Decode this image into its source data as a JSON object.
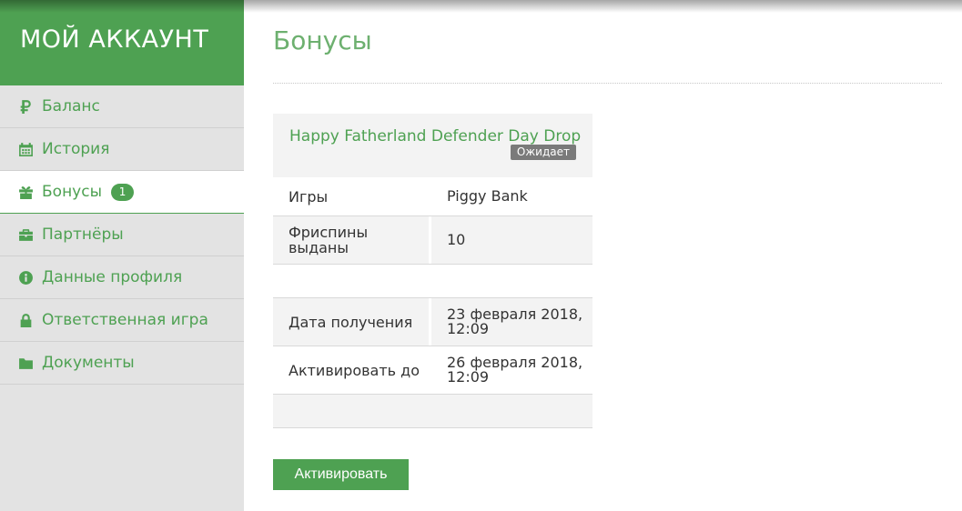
{
  "sidebar": {
    "title": "МОЙ АККАУНТ",
    "items": [
      {
        "label": "Баланс",
        "icon": "ruble-icon"
      },
      {
        "label": "История",
        "icon": "calendar-icon"
      },
      {
        "label": "Бонусы",
        "icon": "gift-icon",
        "badge": "1",
        "active": true
      },
      {
        "label": "Партнёры",
        "icon": "briefcase-icon"
      },
      {
        "label": "Данные профиля",
        "icon": "info-icon"
      },
      {
        "label": "Ответственная игра",
        "icon": "lock-icon"
      },
      {
        "label": "Документы",
        "icon": "folder-icon"
      }
    ]
  },
  "main": {
    "title": "Бонусы",
    "bonus": {
      "name": "Happy Fatherland Defender Day Drop",
      "status": "Ожидает",
      "rows": [
        {
          "label": "Игры",
          "value": "Piggy Bank"
        },
        {
          "label": "Фриспины выданы",
          "value": "10"
        },
        {
          "label": "",
          "value": ""
        },
        {
          "label": "Дата получения",
          "value": "23 февраля 2018, 12:09"
        },
        {
          "label": "Активировать до",
          "value": "26 февраля 2018, 12:09"
        },
        {
          "label": "",
          "value": ""
        }
      ]
    },
    "activate_label": "Активировать"
  },
  "colors": {
    "accent": "#4ea152",
    "sidebar_bg": "#e3e3e3",
    "badge_gray": "#7a7a7a"
  }
}
